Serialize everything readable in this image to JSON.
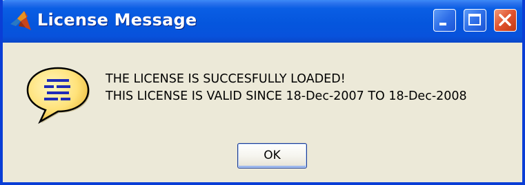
{
  "window": {
    "title": "License Message",
    "controls": {
      "minimize": "minimize-icon",
      "maximize": "maximize-icon",
      "close": "close-icon"
    }
  },
  "message": {
    "icon": "help-speech-bubble-icon",
    "line1": "THE LICENSE IS SUCCESFULLY LOADED!",
    "line2": "THIS LICENSE IS VALID SINCE 18-Dec-2007 TO 18-Dec-2008"
  },
  "buttons": {
    "ok_label": "OK"
  },
  "colors": {
    "titlebar": "#0556dd",
    "window_bg": "#ece9d8",
    "close_button": "#e0522e"
  }
}
